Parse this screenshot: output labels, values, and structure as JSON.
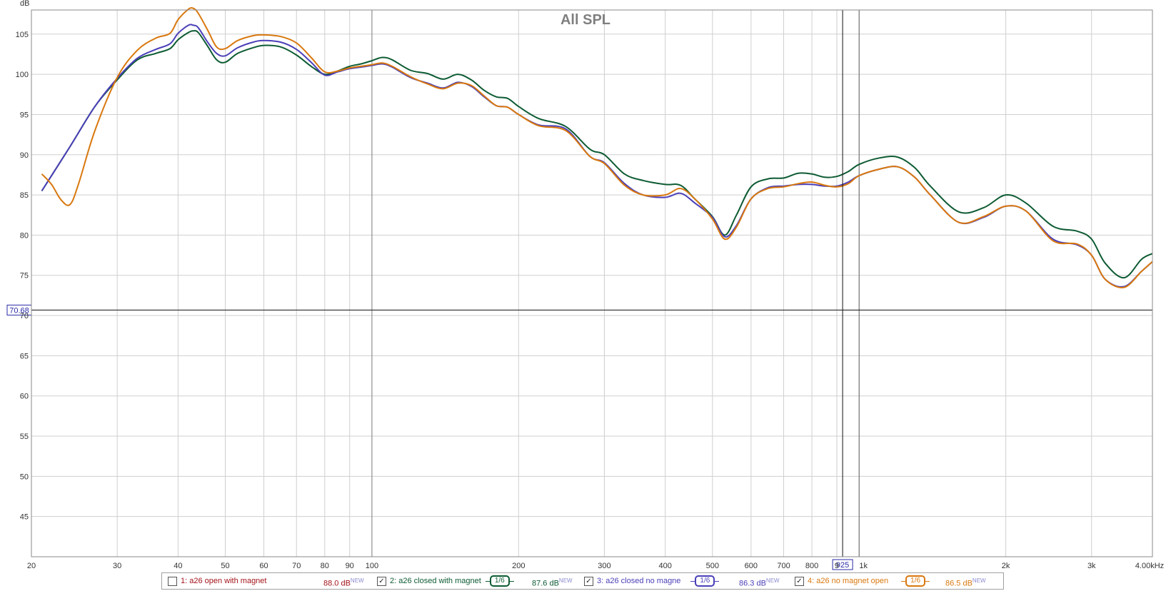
{
  "chart_data": {
    "type": "line",
    "title": "All SPL",
    "ylabel": "dB",
    "xscale": "log",
    "xlim": [
      20,
      4000
    ],
    "ylim": [
      40,
      108
    ],
    "xticks": [
      {
        "value": 20,
        "label": "20"
      },
      {
        "value": 30,
        "label": "30"
      },
      {
        "value": 40,
        "label": "40"
      },
      {
        "value": 50,
        "label": "50"
      },
      {
        "value": 60,
        "label": "60"
      },
      {
        "value": 70,
        "label": "70"
      },
      {
        "value": 80,
        "label": "80"
      },
      {
        "value": 90,
        "label": "90"
      },
      {
        "value": 100,
        "label": "100"
      },
      {
        "value": 200,
        "label": "200"
      },
      {
        "value": 300,
        "label": "300"
      },
      {
        "value": 400,
        "label": "400"
      },
      {
        "value": 500,
        "label": "500"
      },
      {
        "value": 600,
        "label": "600"
      },
      {
        "value": 700,
        "label": "700"
      },
      {
        "value": 800,
        "label": "800"
      },
      {
        "value": 900,
        "label": "9"
      },
      {
        "value": 1000,
        "label": "1k"
      },
      {
        "value": 2000,
        "label": "2k"
      },
      {
        "value": 3000,
        "label": "3k"
      },
      {
        "value": 4000,
        "label": "4.00kHz"
      }
    ],
    "minor_xgrid": [
      200,
      300,
      400,
      500,
      600,
      700,
      800,
      900,
      1000,
      2000,
      3000,
      4000,
      20,
      30,
      40,
      50,
      60,
      70,
      80,
      90,
      100
    ],
    "yticks": [
      45,
      50,
      55,
      60,
      65,
      70,
      75,
      80,
      85,
      90,
      95,
      100,
      105
    ],
    "grid": true,
    "cursor": {
      "y_value": 70.68,
      "y_label": "70.68",
      "x_value": 925,
      "x_label": "925"
    },
    "marker_lines": [
      {
        "value": 100,
        "color": "#808080"
      },
      {
        "value": 1000,
        "color": "#606060"
      }
    ],
    "series": [
      {
        "name": "2: a26 closed  with magnet",
        "color": "#0d5b33",
        "x": [
          21,
          24,
          27,
          30,
          33,
          36,
          38.5,
          40,
          42,
          43,
          44,
          46,
          48,
          50,
          53,
          57,
          60,
          65,
          70,
          75,
          80,
          85,
          90,
          95,
          100,
          105,
          110,
          120,
          130,
          140,
          150,
          160,
          170,
          180,
          190,
          200,
          220,
          250,
          280,
          300,
          330,
          360,
          400,
          430,
          460,
          500,
          530,
          560,
          600,
          650,
          700,
          750,
          800,
          850,
          900,
          950,
          1000,
          1100,
          1200,
          1300,
          1400,
          1600,
          1800,
          2000,
          2200,
          2500,
          2800,
          3000,
          3200,
          3500,
          3800,
          4000
        ],
        "y": [
          85.5,
          91,
          96,
          99.3,
          101.8,
          102.6,
          103.2,
          104.3,
          105.2,
          105.4,
          105.2,
          103.5,
          101.8,
          101.5,
          102.6,
          103.3,
          103.6,
          103.4,
          102.4,
          101,
          100,
          100.4,
          101,
          101.3,
          101.7,
          102.1,
          101.8,
          100.5,
          100.1,
          99.4,
          100,
          99.3,
          98,
          97.2,
          97,
          96,
          94.5,
          93.5,
          90.7,
          90,
          87.6,
          86.8,
          86.3,
          86.2,
          84.5,
          82.3,
          80,
          82.5,
          86,
          87,
          87.1,
          87.7,
          87.6,
          87.2,
          87.3,
          87.9,
          88.8,
          89.6,
          89.7,
          88.4,
          86.1,
          82.9,
          83.4,
          85,
          84,
          81.1,
          80.5,
          79.5,
          76.5,
          74.7,
          77,
          77.7
        ]
      },
      {
        "name": "3: a26 closed no magne",
        "color": "#4a3fb8",
        "x": [
          21,
          24,
          27,
          30,
          33,
          36,
          38.5,
          40,
          42,
          43,
          44,
          46,
          48,
          50,
          53,
          57,
          60,
          65,
          70,
          75,
          80,
          85,
          90,
          95,
          100,
          105,
          110,
          120,
          130,
          140,
          150,
          160,
          170,
          180,
          190,
          200,
          220,
          250,
          280,
          300,
          330,
          360,
          400,
          430,
          460,
          500,
          530,
          560,
          600,
          650,
          700,
          750,
          800,
          850,
          900,
          950,
          1000,
          1100,
          1200,
          1300,
          1400,
          1600,
          1800,
          2000,
          2200,
          2500,
          2800,
          3000,
          3200,
          3500,
          3800,
          4000
        ],
        "y": [
          85.5,
          91,
          96,
          99.5,
          102,
          103.1,
          103.8,
          105.1,
          106.1,
          106.1,
          105.8,
          104,
          102.6,
          102.3,
          103.3,
          104,
          104.2,
          104,
          103.1,
          101.5,
          99.9,
          100.3,
          100.7,
          100.9,
          101.1,
          101.3,
          100.9,
          99.6,
          98.9,
          98.3,
          99,
          98.5,
          97.2,
          96.1,
          95.9,
          95,
          93.7,
          93.2,
          89.8,
          89,
          86.4,
          85,
          84.7,
          85.2,
          84,
          82.2,
          79.8,
          81.2,
          84.5,
          85.9,
          86.1,
          86.3,
          86.3,
          86.1,
          86.1,
          86.6,
          87.4,
          88.2,
          88.5,
          87.2,
          85,
          81.6,
          82.2,
          83.6,
          83,
          79.5,
          78.8,
          77.5,
          74.5,
          73.6,
          75.5,
          76.7
        ]
      },
      {
        "name": "4: a26 no magnet open",
        "color": "#d9780f",
        "x": [
          21,
          22,
          23,
          24,
          25,
          27,
          30,
          33,
          36,
          38.5,
          40,
          42,
          43,
          44,
          46,
          48,
          50,
          53,
          57,
          60,
          65,
          70,
          75,
          80,
          85,
          90,
          95,
          100,
          105,
          110,
          120,
          130,
          140,
          150,
          160,
          170,
          180,
          190,
          200,
          220,
          250,
          280,
          300,
          330,
          360,
          400,
          430,
          460,
          500,
          530,
          560,
          600,
          650,
          700,
          750,
          800,
          850,
          900,
          950,
          1000,
          1100,
          1200,
          1300,
          1400,
          1600,
          1800,
          2000,
          2200,
          2500,
          2800,
          3000,
          3200,
          3500,
          3800,
          4000
        ],
        "y": [
          87.6,
          86.3,
          84.4,
          83.8,
          86.4,
          93,
          99.6,
          103,
          104.5,
          105.1,
          106.8,
          108.1,
          108.2,
          107.6,
          105.5,
          103.4,
          103.2,
          104.2,
          104.8,
          104.9,
          104.7,
          103.9,
          102.1,
          100.3,
          100.4,
          100.8,
          101,
          101.2,
          101.4,
          101,
          99.7,
          98.8,
          98.2,
          98.9,
          98.6,
          97.3,
          96.1,
          95.9,
          95,
          93.6,
          93,
          89.8,
          88.9,
          86.2,
          85,
          85,
          85.8,
          84.5,
          82,
          79.5,
          81,
          84.5,
          85.8,
          86,
          86.4,
          86.6,
          86.2,
          86,
          86.4,
          87.4,
          88.2,
          88.5,
          87.2,
          85,
          81.6,
          82.3,
          83.6,
          83,
          79.3,
          78.9,
          77.5,
          74.5,
          73.5,
          75.5,
          76.7
        ]
      }
    ]
  },
  "legend": {
    "items": [
      {
        "label": "1: a26 open with magnet",
        "checked": false,
        "color": "#a4141b",
        "check_mark": "",
        "smoothing": "",
        "level": "88.0 dB",
        "level_color": "#a4141b",
        "new_tag": "NEW"
      },
      {
        "label": "2: a26 closed  with magnet",
        "checked": true,
        "color": "#0d5b33",
        "check_mark": "✓",
        "smoothing": "1/6",
        "level": "87.6 dB",
        "level_color": "#0d5b33",
        "new_tag": "NEW"
      },
      {
        "label": "3: a26 closed no magne",
        "checked": true,
        "color": "#4a3fb8",
        "check_mark": "✓",
        "smoothing": "1/6",
        "level": "86.3 dB",
        "level_color": "#4a3fb8",
        "new_tag": "NEW"
      },
      {
        "label": "4: a26 no magnet open",
        "checked": true,
        "color": "#d9780f",
        "check_mark": "✓",
        "smoothing": "1/6",
        "level": "86.5 dB",
        "level_color": "#d9780f",
        "new_tag": "NEW"
      }
    ]
  }
}
